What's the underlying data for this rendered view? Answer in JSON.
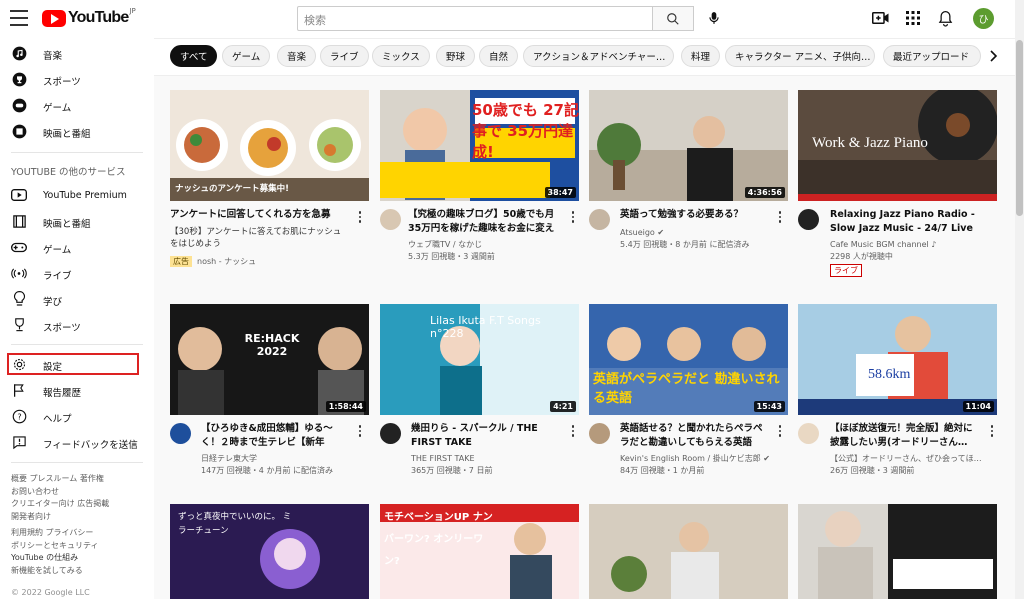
{
  "header": {
    "logo_text": "YouTube",
    "region": "JP",
    "search_placeholder": "検索",
    "avatar_letter": "ひ"
  },
  "sidebar": {
    "top_items": [
      {
        "label": "音楽",
        "icon": "music-icon"
      },
      {
        "label": "スポーツ",
        "icon": "trophy-icon"
      },
      {
        "label": "ゲーム",
        "icon": "gamepad-icon"
      },
      {
        "label": "映画と番組",
        "icon": "film-icon"
      }
    ],
    "services_heading": "YOUTUBE の他のサービス",
    "service_items": [
      {
        "label": "YouTube Premium",
        "icon": "youtube-premium-icon"
      },
      {
        "label": "映画と番組",
        "icon": "film-strip-icon"
      },
      {
        "label": "ゲーム",
        "icon": "gamepad-icon"
      },
      {
        "label": "ライブ",
        "icon": "live-icon"
      },
      {
        "label": "学び",
        "icon": "lightbulb-icon"
      },
      {
        "label": "スポーツ",
        "icon": "trophy-icon"
      }
    ],
    "settings_items": [
      {
        "label": "設定",
        "icon": "gear-icon"
      },
      {
        "label": "報告履歴",
        "icon": "flag-icon"
      },
      {
        "label": "ヘルプ",
        "icon": "help-icon"
      },
      {
        "label": "フィードバックを送信",
        "icon": "feedback-icon"
      }
    ],
    "footer1": [
      "概要 プレスルーム 著作権",
      "お問い合わせ",
      "クリエイター向け 広告掲載",
      "開発者向け"
    ],
    "footer2": [
      "利用規約 プライバシー",
      "ポリシーとセキュリティ",
      "YouTube の仕組み",
      "新機能を試してみる"
    ],
    "copyright": "© 2022 Google LLC"
  },
  "chips": [
    "すべて",
    "ゲーム",
    "音楽",
    "ライブ",
    "ミックス",
    "野球",
    "自然",
    "アクション＆アドベンチャー…",
    "料理",
    "キャラクター アニメ、子供向…",
    "最近アップロード"
  ],
  "videos": [
    {
      "title": "アンケートに回答してくれる方を急募",
      "desc": "【30秒】アンケートに答えてお肌にナッシュをはじめよう",
      "channel": "nosh - ナッシュ",
      "badge": "広告",
      "duration": "",
      "thumb_text": "ナッシュのアンケート募集中!"
    },
    {
      "title": "【究極の趣味ブログ】50歳でも月35万円を稼げた趣味をお金に変える…",
      "channel": "ウェブ職TV / なかじ",
      "meta": "5.3万 回視聴・3 週間前",
      "duration": "38:47",
      "thumb_text": "50歳でも 27記事で 35万円達成!"
    },
    {
      "title": "英語って勉強する必要ある？",
      "channel": "Atsueigo ✔",
      "meta": "5.4万 回視聴・8 か月前 に配信済み",
      "duration": "4:36:56",
      "thumb_text": ""
    },
    {
      "title": "Relaxing Jazz Piano Radio - Slow Jazz Music - 24/7 Live Stream -…",
      "channel": "Cafe Music BGM channel ♪",
      "meta": "2298 人が視聴中",
      "badge": "ライブ",
      "duration": "",
      "thumb_text": "Work & Jazz Piano"
    },
    {
      "title": "【ひろゆき&成田悠輔】ゆる〜く！２時まで生テレビ【新年早々、２…",
      "channel": "日経テレ東大学",
      "meta": "147万 回視聴・4 か月前 に配信済み",
      "duration": "1:58:44",
      "thumb_text": "RE:HACK 2022"
    },
    {
      "title": "幾田りら - スパークル / THE FIRST TAKE",
      "channel": "THE FIRST TAKE",
      "meta": "365万 回視聴・7 日前",
      "duration": "4:21",
      "thumb_text": "Lilas Ikuta F.T Songs n°228"
    },
    {
      "title": "英語話せる？と聞かれたらペラペラだと勘違いしてもらえる英語フ…",
      "channel": "Kevin's English Room / 掛山ケビ志郎 ✔",
      "meta": "84万 回視聴・1 か月前",
      "duration": "15:43",
      "thumb_text": "英語がペラペラだと 勘違いされる英語"
    },
    {
      "title": "【ほぼ放送復元！完全版】絶対に披露したい男(オードリーさん…",
      "channel": "【公式】オードリーさん、ぜひ会ってほ…",
      "meta": "26万 回視聴・3 週間前",
      "duration": "11:04",
      "thumb_text": "58.6km"
    },
    {
      "title": "",
      "channel": "",
      "meta": "",
      "duration": "",
      "thumb_text": "ずっと真夜中でいいのに。 ミラーチューン"
    },
    {
      "title": "",
      "channel": "",
      "meta": "",
      "duration": "",
      "thumb_text": "モチベーションUP ナンバーワン? オンリーワン?"
    },
    {
      "title": "",
      "channel": "",
      "meta": "",
      "duration": "",
      "thumb_text": ""
    },
    {
      "title": "",
      "channel": "",
      "meta": "",
      "duration": "",
      "thumb_text": ""
    }
  ]
}
